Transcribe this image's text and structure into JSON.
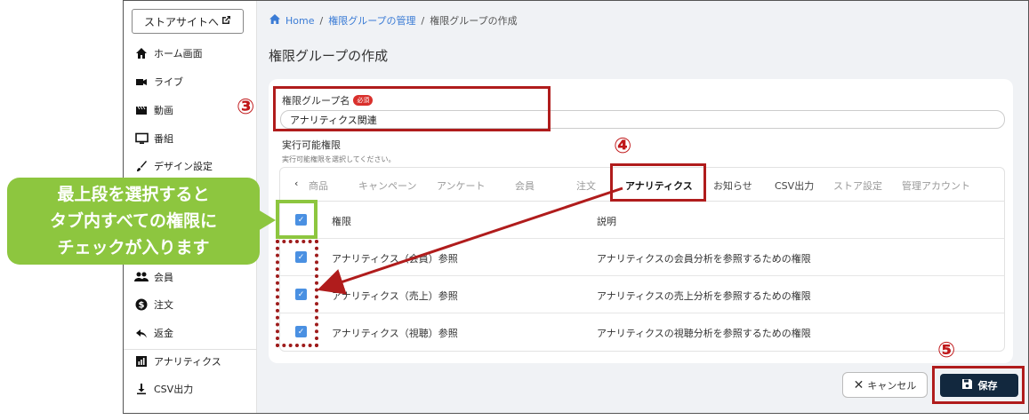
{
  "sidebar": {
    "store_button": "ストアサイトへ",
    "items": [
      {
        "label": "ホーム画面",
        "icon": "home-icon"
      },
      {
        "label": "ライブ",
        "icon": "video-camera-icon"
      },
      {
        "label": "動画",
        "icon": "clapperboard-icon"
      },
      {
        "label": "番組",
        "icon": "monitor-icon"
      },
      {
        "label": "デザイン設定",
        "icon": "brush-icon"
      },
      {
        "label": "会員",
        "icon": "people-icon"
      },
      {
        "label": "注文",
        "icon": "dollar-circle-icon"
      },
      {
        "label": "返金",
        "icon": "reply-icon"
      },
      {
        "label": "アナリティクス",
        "icon": "bar-chart-icon"
      },
      {
        "label": "CSV出力",
        "icon": "download-icon"
      }
    ]
  },
  "breadcrumb": {
    "home": "Home",
    "parent": "権限グループの管理",
    "current": "権限グループの作成"
  },
  "page_title": "権限グループの作成",
  "form": {
    "name_label": "権限グループ名",
    "required_badge": "必須",
    "name_value": "アナリティクス関連",
    "permissions_label": "実行可能権限",
    "permissions_help": "実行可能権限を選択してください。"
  },
  "tabs": [
    "商品",
    "キャンペーン",
    "アンケート",
    "会員",
    "注文",
    "アナリティクス",
    "お知らせ",
    "CSV出力",
    "ストア設定",
    "管理アカウント"
  ],
  "table": {
    "header": {
      "permission": "権限",
      "description": "説明"
    },
    "rows": [
      {
        "permission": "アナリティクス（会員）参照",
        "description": "アナリティクスの会員分析を参照するための権限",
        "checked": true
      },
      {
        "permission": "アナリティクス（売上）参照",
        "description": "アナリティクスの売上分析を参照するための権限",
        "checked": true
      },
      {
        "permission": "アナリティクス（視聴）参照",
        "description": "アナリティクスの視聴分析を参照するための権限",
        "checked": true
      }
    ]
  },
  "buttons": {
    "cancel": "キャンセル",
    "save": "保存"
  },
  "annotations": {
    "step3": "③",
    "step4": "④",
    "step5": "⑤",
    "callout_lines": [
      "最上段を選択すると",
      "タブ内すべての権限に",
      "チェックが入ります"
    ]
  },
  "colors": {
    "annotation_red": "#b01c1c",
    "callout_green": "#8dc63f",
    "checkbox_blue": "#4a90e2",
    "save_navy": "#12283e"
  }
}
